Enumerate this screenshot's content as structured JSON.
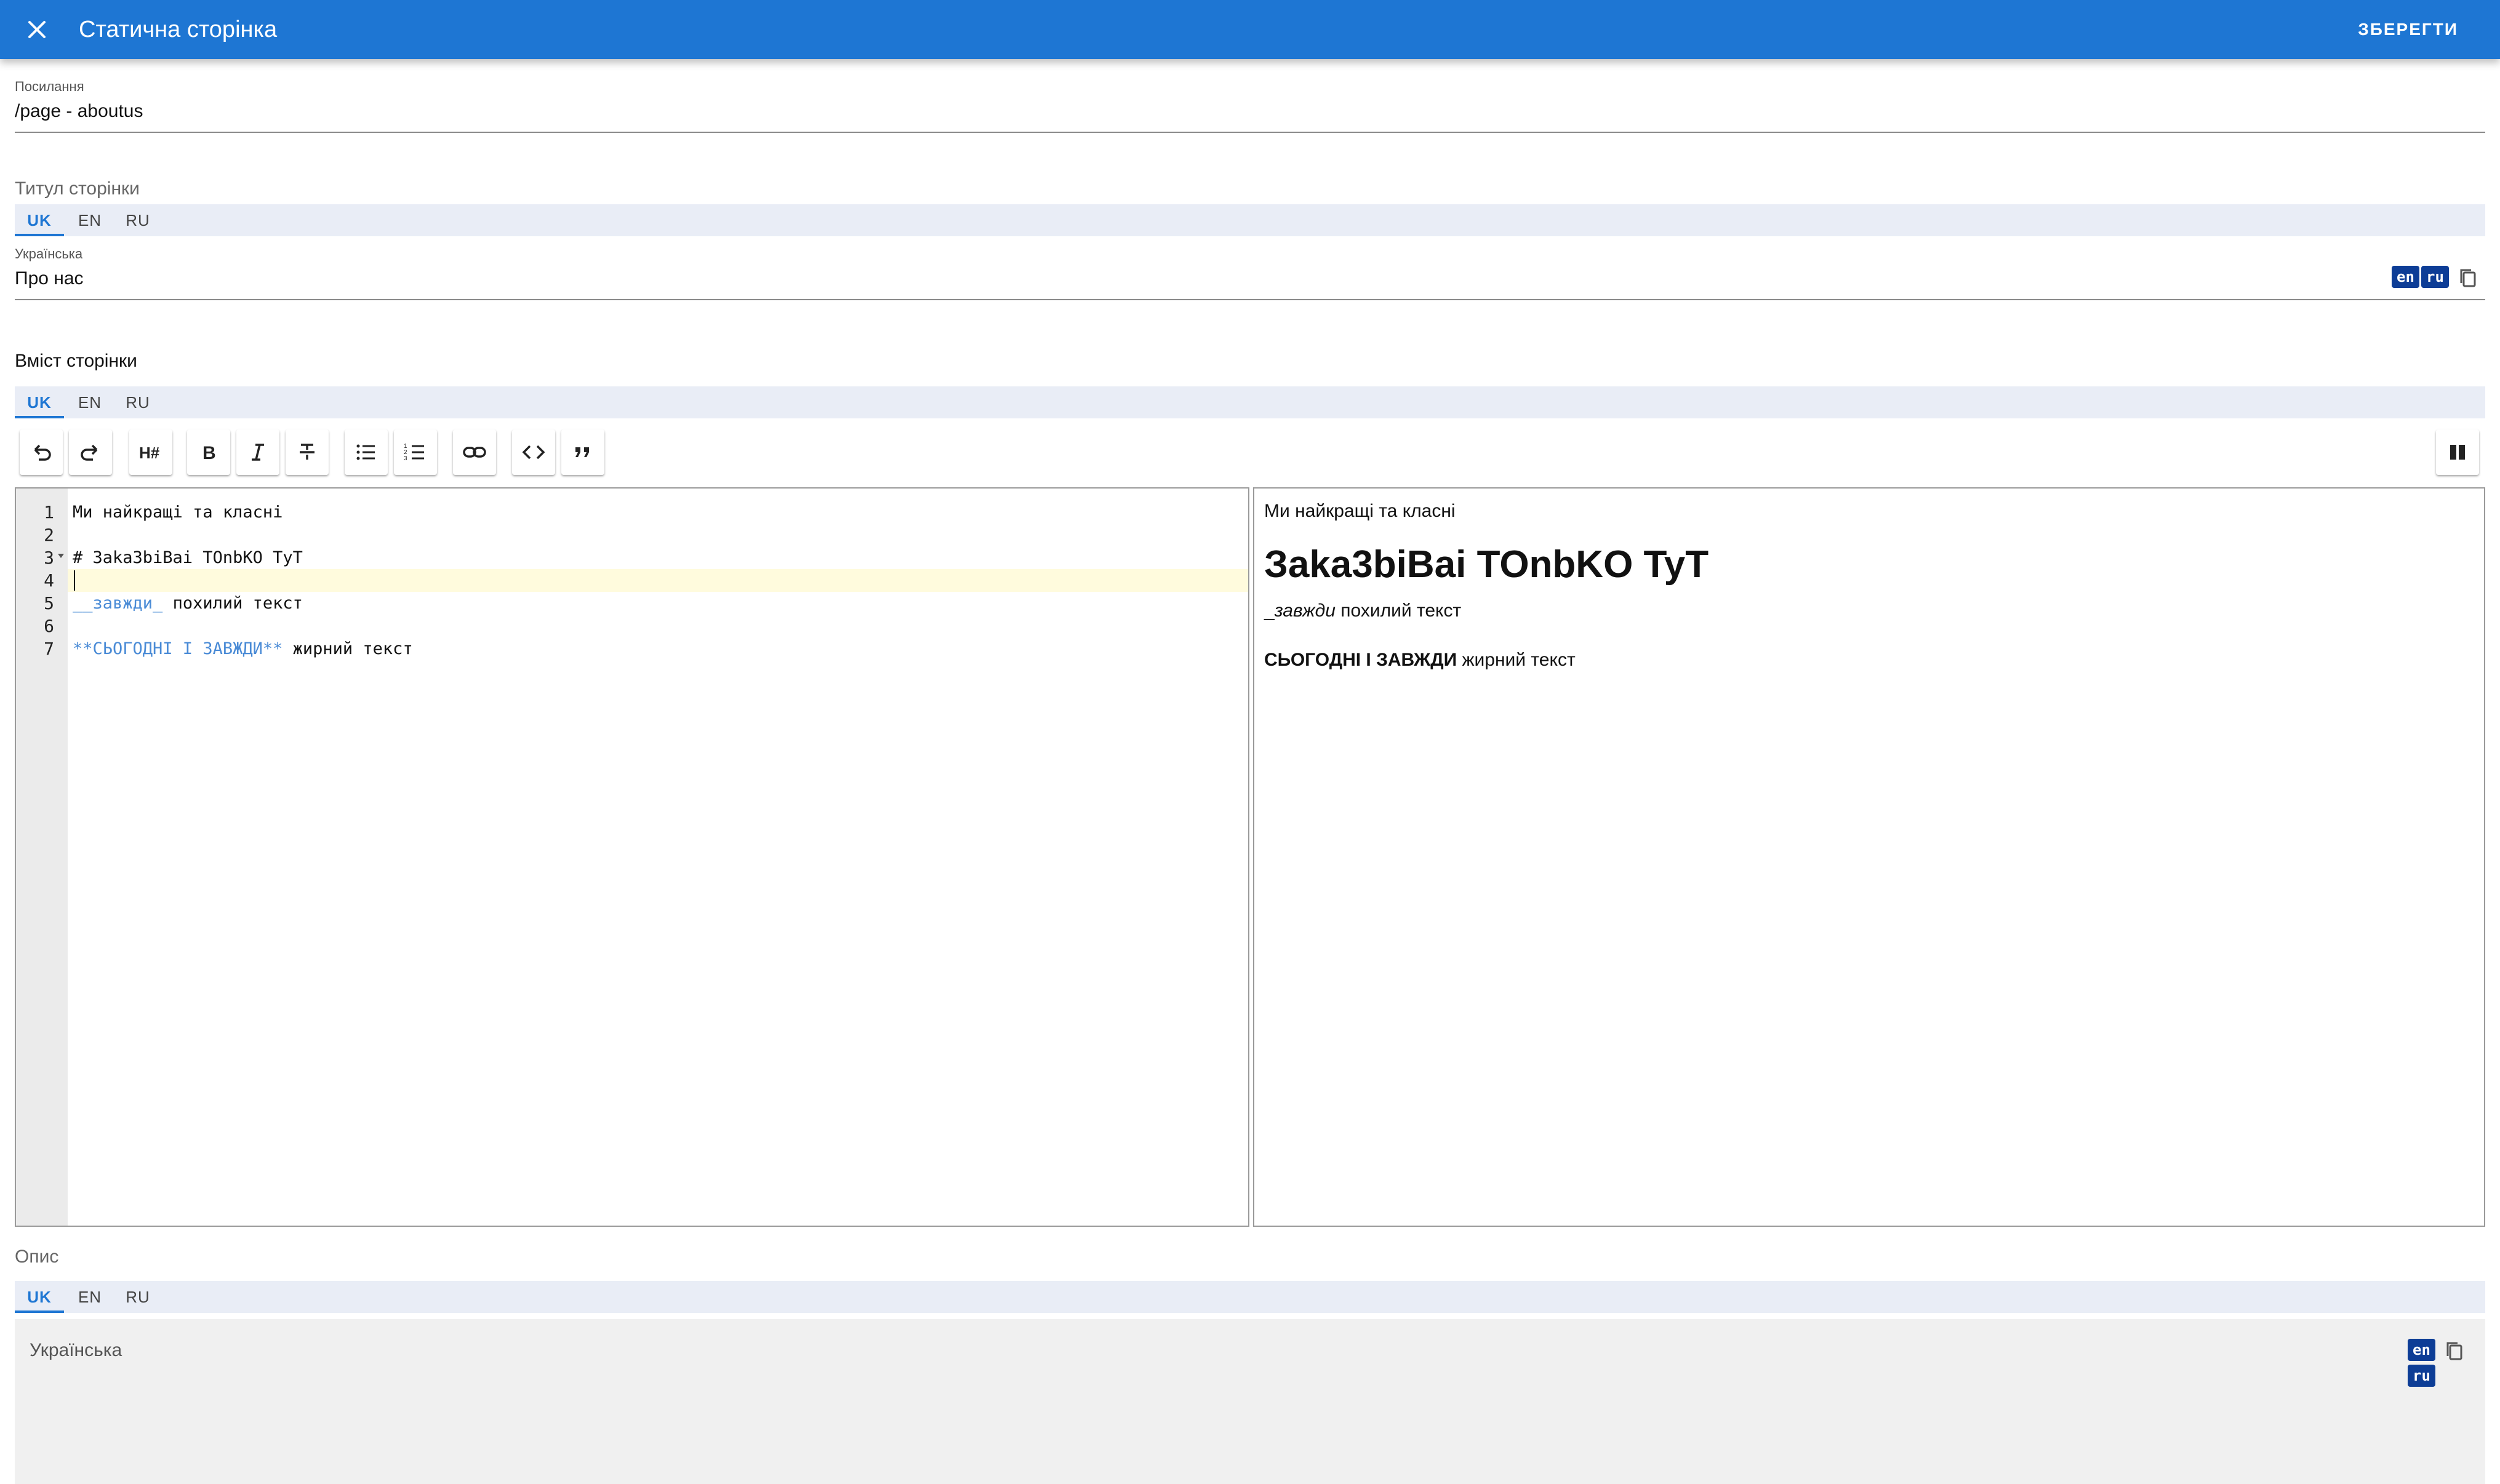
{
  "appbar": {
    "title": "Статична сторінка",
    "save_label": "ЗБЕРЕГТИ",
    "close_icon": "close-icon"
  },
  "link_field": {
    "label": "Посилання",
    "value": "/page - aboutus"
  },
  "title_section": {
    "label": "Титул сторінки",
    "tabs": [
      "UK",
      "EN",
      "RU"
    ],
    "active_tab": "UK",
    "field_label": "Українська",
    "value": "Про нас",
    "chips": [
      "en",
      "ru"
    ]
  },
  "content_section": {
    "label": "Вміст сторінки",
    "tabs": [
      "UK",
      "EN",
      "RU"
    ],
    "active_tab": "UK",
    "toolbar": [
      "undo-icon",
      "redo-icon",
      "heading-icon",
      "bold-icon",
      "italic-icon",
      "strikethrough-icon",
      "bulleted-list-icon",
      "numbered-list-icon",
      "link-icon",
      "code-icon",
      "quote-icon",
      "side-by-side-icon"
    ],
    "editor": {
      "line_numbers": [
        "1",
        "2",
        "3",
        "4",
        "5",
        "6",
        "7"
      ],
      "lines": [
        "Ми найкращі та класні",
        "",
        "# Зaka3biBai TOnbKO TyT",
        "",
        "__завжди_ похилий текст",
        "",
        "**СЬОГОДНІ І ЗАВЖДИ** жирний текст"
      ],
      "line5_md": "__завжди_",
      "line5_rest": " похилий текст",
      "line7_md": "**СЬОГОДНІ І ЗАВЖДИ**",
      "line7_rest": " жирний текст"
    },
    "preview": {
      "p1": "Ми найкращі та класні",
      "h1": "Зaka3biBai TOnbKO TyT",
      "p2_prefix": "_",
      "p2_italic": "завжди",
      "p2_rest": " похилий текст",
      "p3_bold": "СЬОГОДНІ І ЗАВЖДИ",
      "p3_rest": " жирний текст"
    }
  },
  "description_section": {
    "label": "Опис",
    "tabs": [
      "UK",
      "EN",
      "RU"
    ],
    "active_tab": "UK",
    "field_label": "Українська",
    "chips": [
      "en",
      "ru"
    ]
  },
  "colors": {
    "appbar": "#1e76d3",
    "chip": "#0d3d96",
    "tab_bar": "#e9edf6",
    "markdown_syntax": "#4a8bd6"
  }
}
